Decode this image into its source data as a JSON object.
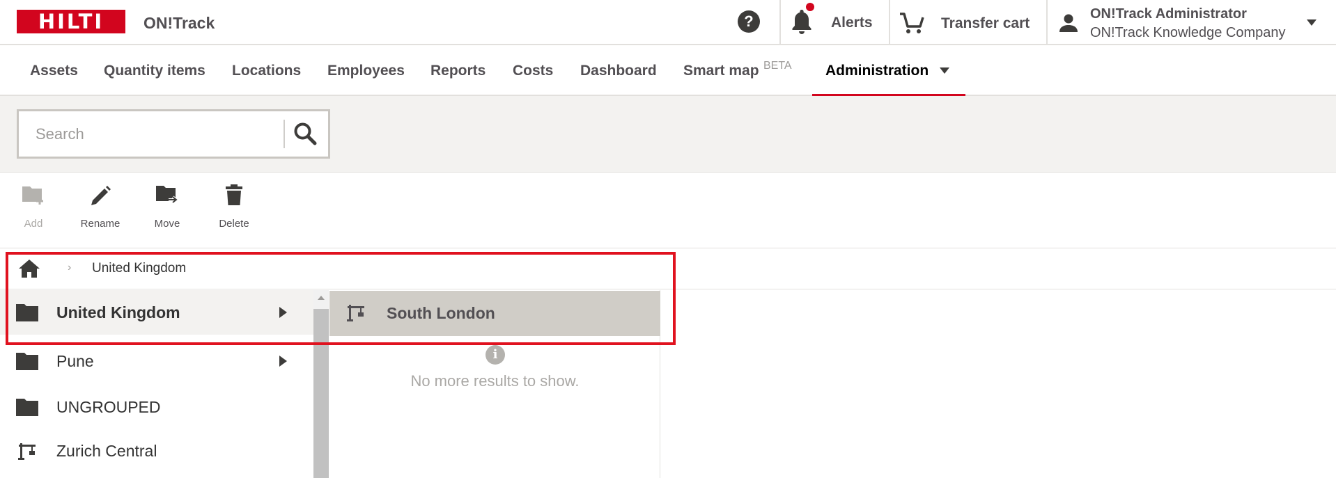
{
  "header": {
    "logo_text": "HILTI",
    "app_name": "ON!Track",
    "help_glyph": "?",
    "alerts_label": "Alerts",
    "transfer_cart_label": "Transfer cart",
    "user_name": "ON!Track Administrator",
    "company_name": "ON!Track Knowledge Company",
    "brand_color": "#d2051e"
  },
  "nav": {
    "items": [
      {
        "label": "Assets"
      },
      {
        "label": "Quantity items"
      },
      {
        "label": "Locations"
      },
      {
        "label": "Employees"
      },
      {
        "label": "Reports"
      },
      {
        "label": "Costs"
      },
      {
        "label": "Dashboard"
      },
      {
        "label": "Smart map"
      },
      {
        "label": "Administration"
      }
    ],
    "beta_label": "BETA",
    "active": "Administration"
  },
  "search": {
    "placeholder": "Search",
    "value": ""
  },
  "toolbar": {
    "add_label": "Add",
    "rename_label": "Rename",
    "move_label": "Move",
    "delete_label": "Delete"
  },
  "breadcrumb": {
    "separator": "›",
    "current": "United Kingdom"
  },
  "tree": {
    "items": [
      {
        "label": "United Kingdom",
        "icon": "folder-icon",
        "has_children": true,
        "selected": true
      },
      {
        "label": "Pune",
        "icon": "folder-icon",
        "has_children": true,
        "selected": false
      },
      {
        "label": "UNGROUPED",
        "icon": "folder-icon",
        "has_children": false,
        "selected": false
      },
      {
        "label": "Zurich Central",
        "icon": "crane-icon",
        "has_children": false,
        "selected": false
      }
    ]
  },
  "children": {
    "items": [
      {
        "label": "South London",
        "icon": "crane-icon"
      }
    ],
    "info_glyph": "i",
    "empty_message": "No more results to show."
  }
}
